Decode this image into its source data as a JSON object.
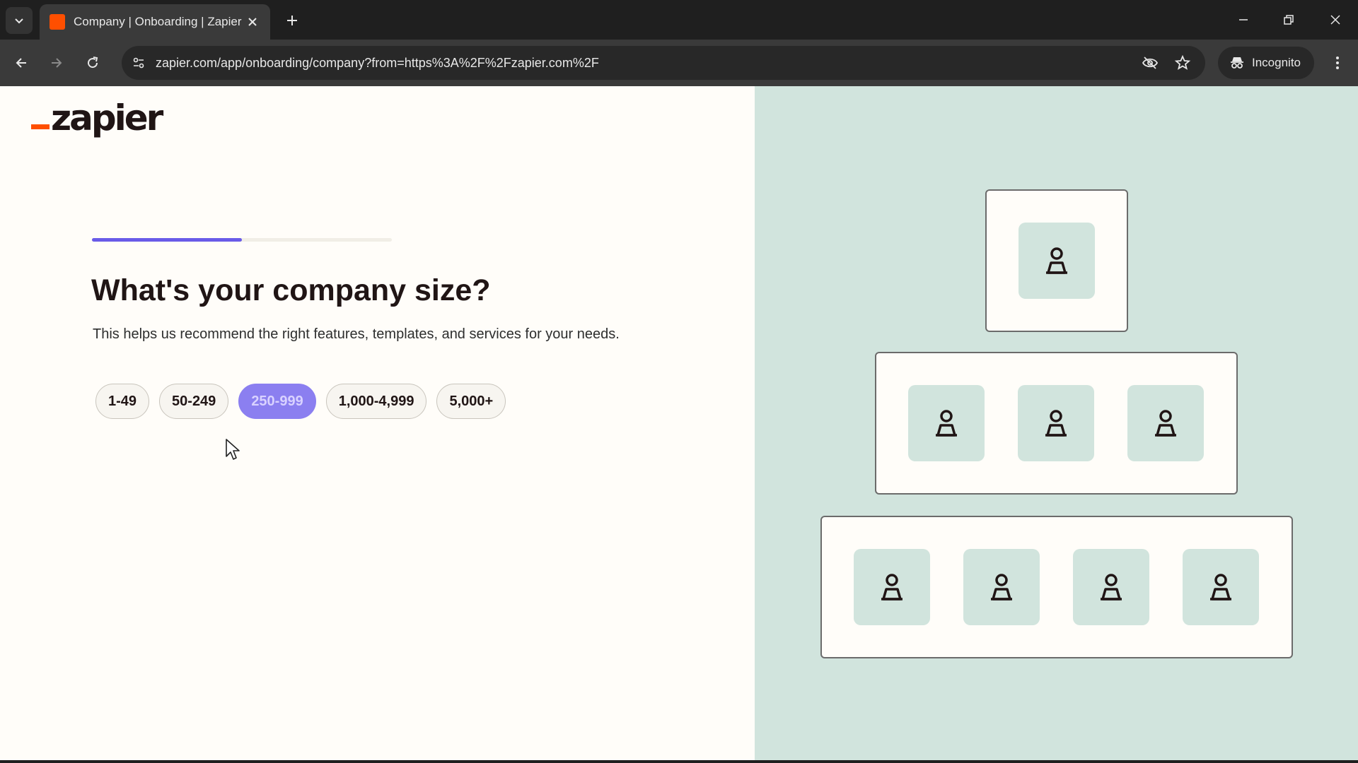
{
  "browser": {
    "tab_title": "Company | Onboarding | Zapier",
    "url": "zapier.com/app/onboarding/company?from=https%3A%2F%2Fzapier.com%2F",
    "incognito_label": "Incognito"
  },
  "page": {
    "logo_text": "zapier",
    "progress_fraction": 0.5,
    "heading": "What's your company size?",
    "subtitle": "This helps us recommend the right features, templates, and services for your needs.",
    "options": [
      {
        "label": "1-49",
        "selected": false
      },
      {
        "label": "50-249",
        "selected": false
      },
      {
        "label": "250-999",
        "selected": true
      },
      {
        "label": "1,000-4,999",
        "selected": false
      },
      {
        "label": "5,000+",
        "selected": false
      }
    ]
  },
  "colors": {
    "brand_orange": "#ff4f00",
    "accent_purple": "#695be8",
    "illustration_bg": "#d1e4dd"
  }
}
